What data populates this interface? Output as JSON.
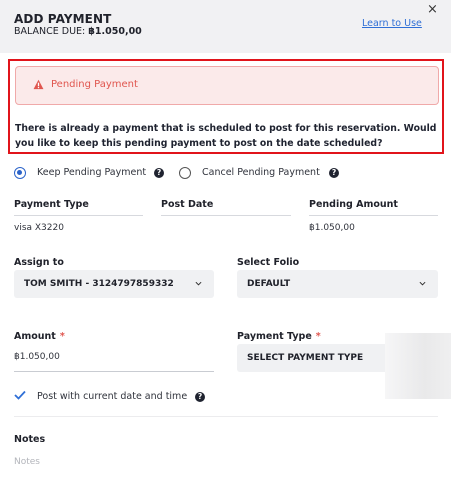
{
  "header": {
    "title": "ADD PAYMENT",
    "balance_label": "BALANCE DUE:",
    "balance_value": "฿1.050,00",
    "learn_link": "Learn to Use",
    "close_glyph": "×"
  },
  "alert": {
    "icon": "warning-triangle-icon",
    "title": "Pending Payment",
    "message": "There is already a payment that is scheduled to post for this reservation. Would you like to keep this pending payment to post on the date scheduled?"
  },
  "pending_choice": {
    "keep_label": "Keep Pending Payment",
    "cancel_label": "Cancel Pending Payment",
    "selected": "keep"
  },
  "pending_table": {
    "headers": [
      "Payment Type",
      "Post Date",
      "Pending Amount"
    ],
    "row": [
      "visa X3220",
      "",
      "฿1.050,00"
    ]
  },
  "assign": {
    "label": "Assign to",
    "value": "TOM SMITH - 3124797859332"
  },
  "folio": {
    "label": "Select Folio",
    "value": "DEFAULT"
  },
  "amount": {
    "label": "Amount",
    "required_mark": "*",
    "value": "฿1.050,00"
  },
  "payment_type": {
    "label": "Payment Type",
    "required_mark": "*",
    "value": "SELECT PAYMENT TYPE"
  },
  "post_current": {
    "label": "Post with current date and time",
    "checked": true
  },
  "notes": {
    "label": "Notes",
    "placeholder": "Notes"
  },
  "colors": {
    "accent": "#2f6fd6",
    "alert_border": "#e1141b",
    "alert_text": "#e0564f"
  }
}
